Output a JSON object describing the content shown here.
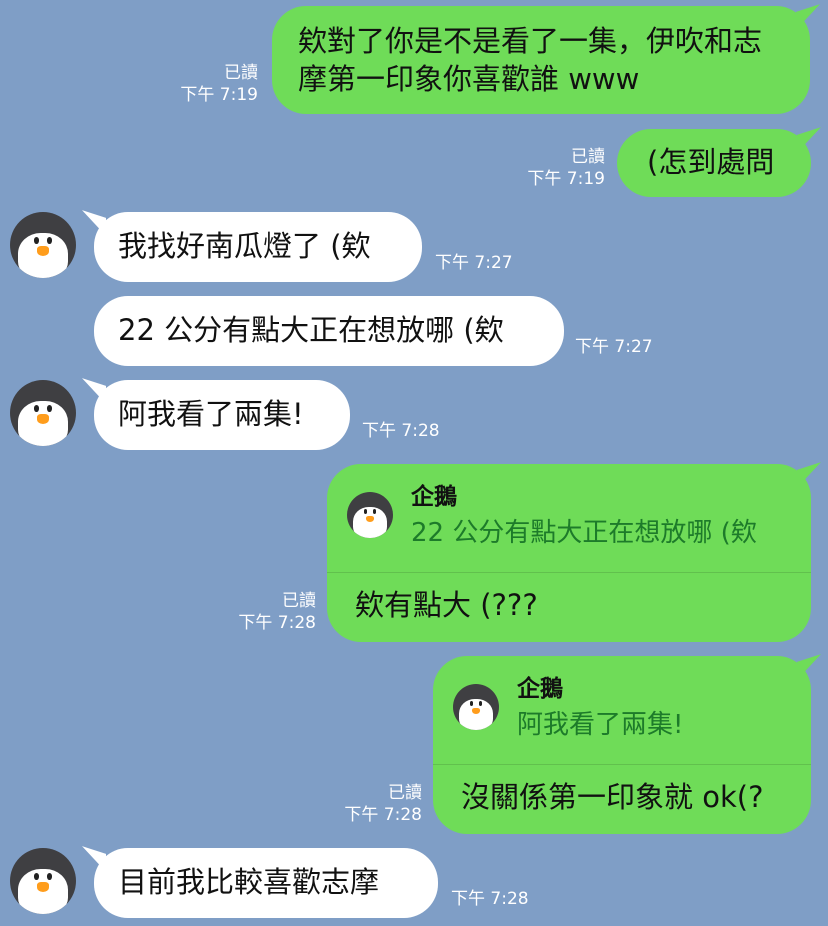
{
  "messages": [
    {
      "text": "欸對了你是不是看了一集，伊吹和志摩第一印象你喜歡誰 www",
      "read": "已讀",
      "time": "下午 7:19"
    },
    {
      "text": "(怎到處問",
      "read": "已讀",
      "time": "下午 7:19"
    },
    {
      "text": "我找好南瓜燈了 (欸",
      "time": "下午 7:27"
    },
    {
      "text": "22 公分有點大正在想放哪 (欸",
      "time": "下午 7:27"
    },
    {
      "text": "阿我看了兩集!",
      "time": "下午 7:28"
    },
    {
      "quote_name": "企鵝",
      "quote_text": "22 公分有點大正在想放哪 (欸",
      "text": "欸有點大 (???",
      "read": "已讀",
      "time": "下午 7:28"
    },
    {
      "quote_name": "企鵝",
      "quote_text": "阿我看了兩集!",
      "text": "沒關係第一印象就 ok(?",
      "read": "已讀",
      "time": "下午 7:28"
    },
    {
      "text": "目前我比較喜歡志摩",
      "time": "下午 7:28"
    }
  ],
  "colors": {
    "background": "#7f9ec6",
    "my_bubble": "#6fdc58",
    "their_bubble": "#ffffff",
    "quote_text": "#1d7b2a"
  },
  "icons": {
    "avatar": "penguin-avatar-icon"
  }
}
